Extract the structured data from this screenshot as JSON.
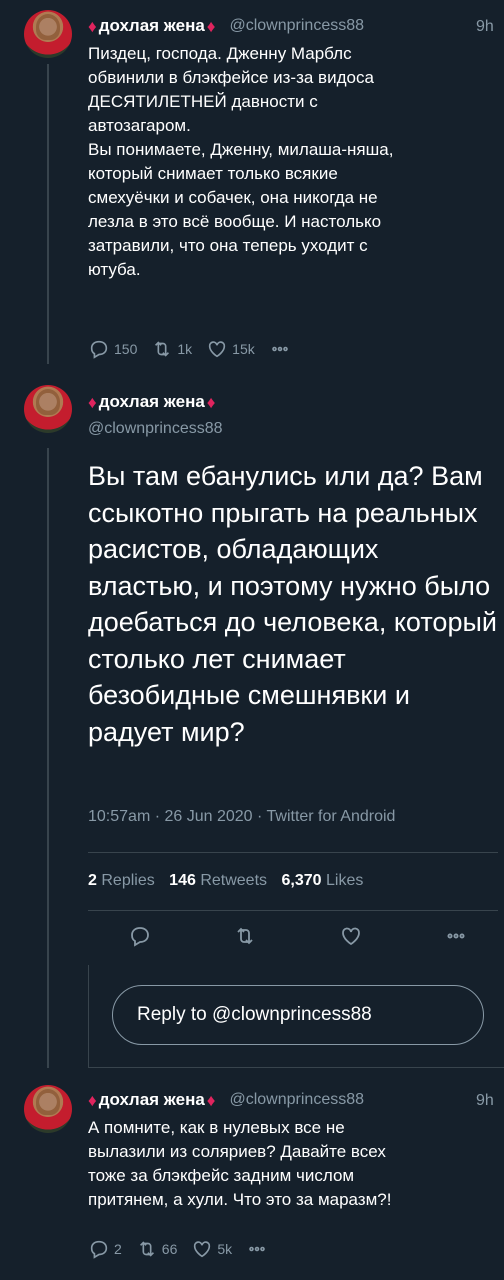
{
  "tweet1": {
    "name": "дохлая жена",
    "diamond": "♦",
    "handle": "@clownprincess88",
    "time": "9h",
    "text": "Пиздец, господа. Дженну Марблс\nобвинили в блэкфейсе из-за видоса\nДЕСЯТИЛЕТНЕЙ давности с\nавтозагаром.\nВы понимаете, Дженну, милаша-няша,\nкоторый снимает только всякие\nсмехуёчки и собачек, она никогда не\nлезла в это всё вообще. И настолько\nзатравили, что она теперь уходит с\nютуба.",
    "replies": "150",
    "retweets": "1k",
    "likes": "15k"
  },
  "main": {
    "name": "дохлая жена",
    "diamond": "♦",
    "handle": "@clownprincess88",
    "text": "Вы там ебанулись или да? Вам ссыкотно прыгать на реальных расистов, обладающих властью, и поэтому нужно было доебаться до человека, который столько лет снимает безобидные смешнявки и радует мир?",
    "meta": "10:57am · 26 Jun 2020 · Twitter for Android",
    "stats": {
      "replies_count": "2",
      "replies_label": "Replies",
      "retweets_count": "146",
      "retweets_label": "Retweets",
      "likes_count": "6,370",
      "likes_label": "Likes"
    },
    "reply_prompt": "Reply to @clownprincess88"
  },
  "tweet3": {
    "name": "дохлая жена",
    "diamond": "♦",
    "handle": "@clownprincess88",
    "time": "9h",
    "text": "А помните, как в нулевых все не\nвылазили из соляриев? Давайте  всех\nтоже за блэкфейс задним числом\nпритянем, а хули. Что это за маразм?!",
    "replies": "2",
    "retweets": "66",
    "likes": "5k"
  },
  "icons": [
    "reply-icon",
    "retweet-icon",
    "like-icon",
    "more-icon"
  ],
  "colors": {
    "background": "#15202b",
    "text": "#ffffff",
    "secondary": "#8899a6",
    "divider": "#38444d",
    "diamond": "#e0245e"
  }
}
